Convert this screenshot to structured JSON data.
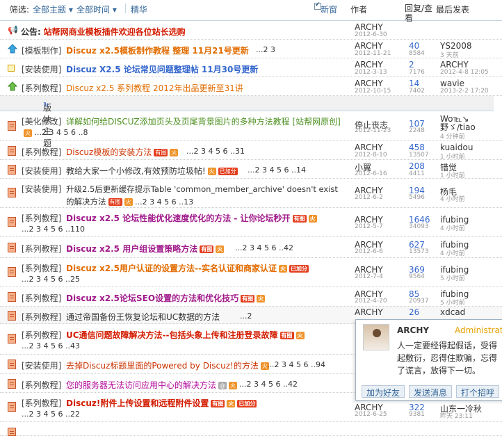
{
  "filter": {
    "label": "筛选:",
    "all_topics": "全部主题",
    "all_time": "全部时间",
    "digest": "精华",
    "new_window": "新窗"
  },
  "columns": {
    "author": "作者",
    "replies": "回复/查看",
    "last_post": "最后发表"
  },
  "sticky": [
    {
      "cat": "",
      "title": "公告: 站帮网商业模板插件欢迎各位站长选购",
      "pages": "",
      "author": "ARCHY",
      "date": "2012-6-30",
      "replies": "",
      "views": "",
      "last": "",
      "last_time": ""
    },
    {
      "cat": "[模板制作]",
      "title": "Discuz x2.5模板制作教程 整理 11月21号更新",
      "pages": "...2 3",
      "author": "ARCHY",
      "date": "2012-11-21",
      "replies": "40",
      "views": "8584",
      "last": "YS2008",
      "last_time": "3 天前"
    },
    {
      "cat": "[安装使用]",
      "title": "Discuz X2.5 论坛常见问题整理帖 11月30号更新",
      "pages": "",
      "author": "ARCHY",
      "date": "2012-3-13",
      "replies": "2",
      "views": "7176",
      "last": "ARCHY",
      "last_time": "2012-4-8 12:05"
    },
    {
      "cat": "[系列教程]",
      "title": "Discuz x2.5 系列教程 2012年出品更新至31讲",
      "pages": "",
      "author": "ARCHY",
      "date": "2012-10-15",
      "replies": "14",
      "views": "7402",
      "last": "wavie",
      "last_time": "2013-2-2 17:20"
    }
  ],
  "section_title": "版块主题",
  "threads": [
    {
      "cat": "[美化修改]",
      "title": "详解如何给DISCUZ添加页头及页尾背景图片的多种方法教程 [站帮网原创]",
      "pages": "...2 3 4 5 6 ..8",
      "author": "停止丧志",
      "date": "2012-11-23",
      "replies": "107",
      "views": "2248",
      "last": "Wo℡↘野ゞ/tiao",
      "last_time": "4 分钟前"
    },
    {
      "cat": "[系列教程]",
      "title": "Discuz模板的安装方法",
      "pages": "...2 3 4 5 6 ..31",
      "author": "ARCHY",
      "date": "2012-8-10",
      "replies": "458",
      "views": "13507",
      "last": "kuaidou",
      "last_time": "1 小时前"
    },
    {
      "cat": "[安装使用]",
      "title": "教给大家一个小修改,有效预防垃圾帖!",
      "pages": "...2 3 4 5 6 ..14",
      "author": "小翼",
      "date": "2012-6-16",
      "replies": "208",
      "views": "4411",
      "last": "错觉",
      "last_time": "1 小时前"
    },
    {
      "cat": "[安装使用]",
      "title": "升级2.5后更新缓存提示Table 'common_member_archive' doesn't exist的解决方法",
      "pages": "...2 3 4 5 6 ..13",
      "author": "ARCHY",
      "date": "2012-6-2",
      "replies": "194",
      "views": "5496",
      "last": "杨毛",
      "last_time": "4 小时前"
    },
    {
      "cat": "[系列教程]",
      "title": "Discuz x2.5 论坛性能优化速度优化的方法 - 让你论坛秒开",
      "pages": "...2 3 4 5 6 ..110",
      "author": "ARCHY",
      "date": "2012-5-7",
      "replies": "1646",
      "views": "34093",
      "last": "ifubing",
      "last_time": "4 小时前"
    },
    {
      "cat": "[系列教程]",
      "title": "Discuz x2.5 用户组设置策略方法",
      "pages": "...2 3 4 5 6 ..42",
      "author": "ARCHY",
      "date": "2012-6-6",
      "replies": "627",
      "views": "13573",
      "last": "ifubing",
      "last_time": "4 小时前"
    },
    {
      "cat": "[系列教程]",
      "title": "Discuz x2.5用户认证的设置方法--实名认证和商家认证",
      "pages": "...2 3 4 5 6 ..25",
      "author": "ARCHY",
      "date": "2012-7-4",
      "replies": "369",
      "views": "9564",
      "last": "ifubing",
      "last_time": "5 小时前"
    },
    {
      "cat": "[系列教程]",
      "title": "Discuz x2.5论坛SEO设置的方法和优化技巧",
      "pages": "",
      "author": "ARCHY",
      "date": "2012-4-20",
      "replies": "85",
      "views": "20937",
      "last": "ifubing",
      "last_time": "5 小时前"
    },
    {
      "cat": "[系列教程]",
      "title": "通过帝国备份王恢复论坛和UC数据的方法",
      "pages": "...2",
      "author": "ARCHY",
      "date": "",
      "replies": "26",
      "views": "",
      "last": "xdcad",
      "last_time": ""
    },
    {
      "cat": "[系列教程]",
      "title": "UC通信问题故障解决方法--包括头象上传和注册登录故障",
      "pages": "...2 3 4 5 6 ..43",
      "author": "",
      "date": "",
      "replies": "",
      "views": "",
      "last": "",
      "last_time": ""
    },
    {
      "cat": "[安装使用]",
      "title": "去掉Discuz标题里面的Powered by Discuz!的方法",
      "pages": "...2 3 4 5 6 ..94",
      "author": "",
      "date": "",
      "replies": "",
      "views": "",
      "last": "",
      "last_time": ""
    },
    {
      "cat": "[系列教程]",
      "title": "您的服务器无法访问应用中心的解决方法",
      "pages": "...2 3 4 5 6 ..42",
      "author": "",
      "date": "",
      "replies": "",
      "views": "",
      "last": "",
      "last_time": ""
    },
    {
      "cat": "[系列教程]",
      "title": "Discuz!附件上传设置和远程附件设置",
      "pages": "...2 3 4 5 6 ..22",
      "author": "ARCHY",
      "date": "2012-6-25",
      "replies": "322",
      "views": "9381",
      "last": "山东一冷秋",
      "last_time": "昨天 23:11"
    }
  ],
  "badges": {
    "img": "有图",
    "hot": "火",
    "paid": "已加分"
  },
  "popup": {
    "name": "ARCHY",
    "role": "Administrator",
    "text": "人一定要经得起假话，受得起敷衍，忍得住欺骗，忘得了谎言，放得下一切。",
    "buttons": [
      "加为好友",
      "发送消息",
      "打个招呼"
    ]
  },
  "colors": {
    "accent": "#336699",
    "orange": "#e26c00",
    "purple": "#a0198a",
    "border": "#c2d5e3"
  }
}
